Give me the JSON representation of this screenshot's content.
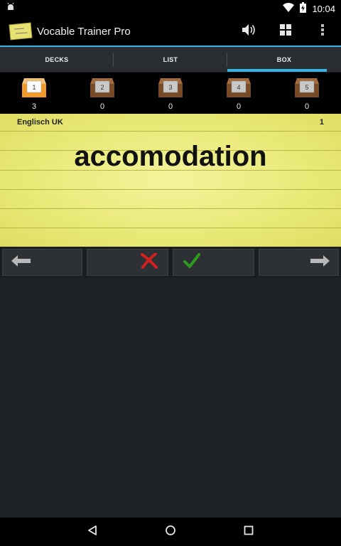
{
  "status_bar": {
    "time": "10:04",
    "icons": [
      "android-debug-icon",
      "wifi-icon",
      "battery-icon"
    ]
  },
  "action_bar": {
    "title": "Vocable Trainer Pro",
    "icons": [
      "app-icon",
      "speaker-icon",
      "grid-icon",
      "overflow-menu-icon"
    ]
  },
  "tabs": [
    {
      "label": "DECKS",
      "active": false
    },
    {
      "label": "LIST",
      "active": false
    },
    {
      "label": "BOX",
      "active": true
    }
  ],
  "boxes": [
    {
      "label": "1",
      "count": "3",
      "active": true
    },
    {
      "label": "2",
      "count": "0",
      "active": false
    },
    {
      "label": "3",
      "count": "0",
      "active": false
    },
    {
      "label": "4",
      "count": "0",
      "active": false
    },
    {
      "label": "5",
      "count": "0",
      "active": false
    }
  ],
  "card": {
    "deck": "Englisch UK",
    "number": "1",
    "word": "accomodation"
  },
  "controls": [
    "back-arrow-icon",
    "wrong-x-icon",
    "correct-check-icon",
    "forward-arrow-icon"
  ],
  "colors": {
    "accent": "#33b5e5",
    "card": "#eaea7a",
    "wrong": "#d42020",
    "correct": "#2e9a1e"
  },
  "nav_bar": [
    "back-icon",
    "home-icon",
    "recents-icon"
  ]
}
